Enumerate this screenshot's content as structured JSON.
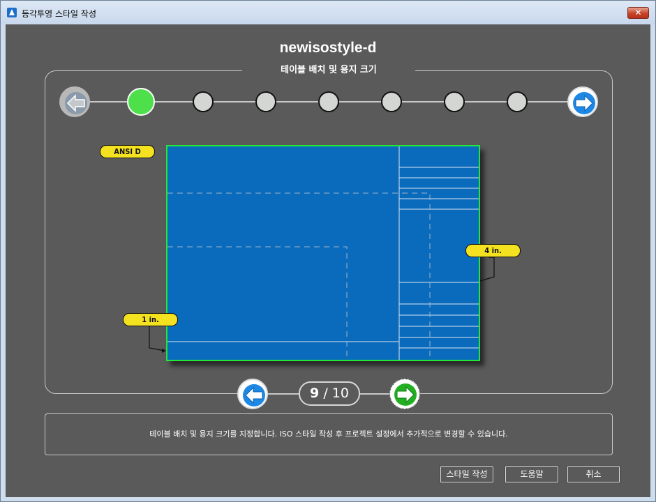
{
  "window": {
    "title": "등각투영 스타일 작성",
    "close_label": "✕"
  },
  "style_name": "newisostyle-d",
  "section_title": "테이블 배치 및 용지 크기",
  "steps": {
    "total_dots": 8,
    "active_index": 0
  },
  "preview": {
    "sheet_size_label": "ANSI D",
    "right_dim_label": "4 in.",
    "bottom_dim_label": "1 in."
  },
  "pager": {
    "current": "9",
    "total": "/ 10"
  },
  "description": "테이블 배치 및 용지 크기를 지정합니다. ISO 스타일 작성 후 프로젝트 설정에서 추가적으로 변경할 수 있습니다.",
  "buttons": {
    "create": "스타일 작성",
    "help": "도움말",
    "cancel": "취소"
  },
  "colors": {
    "background": "#5a5a5a",
    "sheet": "#0a6bbd",
    "sheet_border": "#22e83a",
    "active_step": "#4de04a",
    "tag": "#f4e221",
    "nav_blue": "#1e88e5",
    "nav_green": "#22b022"
  }
}
